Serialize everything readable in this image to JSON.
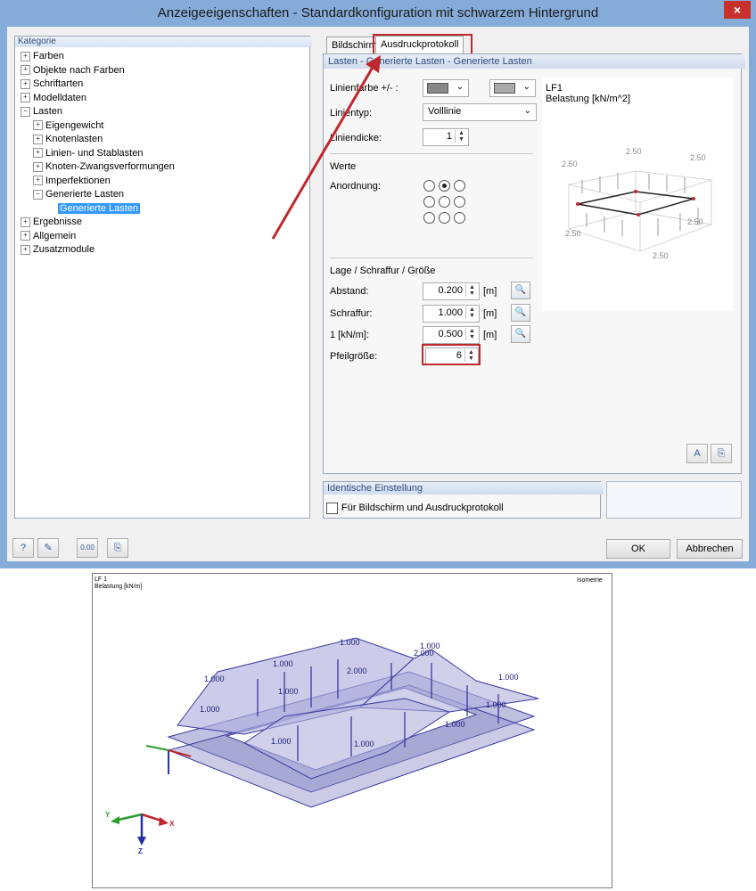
{
  "window": {
    "title": "Anzeigeeigenschaften - Standardkonfiguration mit schwarzem Hintergrund",
    "close": "×"
  },
  "tree": {
    "header": "Kategorie",
    "items": [
      {
        "label": "Farben",
        "exp": "+"
      },
      {
        "label": "Objekte nach Farben",
        "exp": "+"
      },
      {
        "label": "Schriftarten",
        "exp": "+"
      },
      {
        "label": "Modelldaten",
        "exp": "+"
      },
      {
        "label": "Lasten",
        "exp": "−"
      },
      {
        "label": "Eigengewicht",
        "exp": "+"
      },
      {
        "label": "Knotenlasten",
        "exp": "+"
      },
      {
        "label": "Linien- und Stablasten",
        "exp": "+"
      },
      {
        "label": "Knoten-Zwangsverformungen",
        "exp": "+"
      },
      {
        "label": "Imperfektionen",
        "exp": "+"
      },
      {
        "label": "Generierte Lasten",
        "exp": "−"
      },
      {
        "label": "Generierte Lasten",
        "exp": ""
      },
      {
        "label": "Ergebnisse",
        "exp": "+"
      },
      {
        "label": "Allgemein",
        "exp": "+"
      },
      {
        "label": "Zusatzmodule",
        "exp": "+"
      }
    ]
  },
  "tabs": {
    "screen": "Bildschirm",
    "print": "Ausdruckprotokoll"
  },
  "panel": {
    "header": "Lasten - Generierte Lasten - Generierte Lasten",
    "line_color_label": "Linienfarbe +/- :",
    "line_type_label": "Linientyp:",
    "line_type_value": "Volllinie",
    "line_width_label": "Liniendicke:",
    "line_width_value": "1",
    "values_label": "Werte",
    "arrangement_label": "Anordnung:",
    "position_group": "Lage / Schraffur / Größe",
    "distance_label": "Abstand:",
    "distance_value": "0.200",
    "hatch_label": "Schraffur:",
    "hatch_value": "1.000",
    "scale_label": "1 [kN/m]:",
    "scale_value": "0.500",
    "unit_m": "[m]",
    "arrow_size_label": "Pfeilgröße:",
    "arrow_size_value": "6"
  },
  "preview": {
    "line1": "LF1",
    "line2": "Belastung [kN/m^2]",
    "labels": [
      "2.50",
      "2.50",
      "2.50",
      "2.50",
      "2.50",
      "2.50"
    ]
  },
  "ident": {
    "header": "Identische Einstellung",
    "checkbox_label": "Für Bildschirm und Ausdruckprotokoll"
  },
  "buttons": {
    "ok": "OK",
    "cancel": "Abbrechen"
  },
  "printout": {
    "line1": "LF 1",
    "line2": "Belastung [kN/m]",
    "view": "Isometrie",
    "load_labels": [
      "1.000",
      "1.000",
      "1.000",
      "2.000",
      "2.000",
      "1.000",
      "1.000",
      "1.000",
      "1.000",
      "1.000",
      "1.000",
      "1.000",
      "1.000"
    ],
    "axes": {
      "x": "X",
      "y": "Y",
      "z": "Z"
    }
  },
  "colors": {
    "accent": "#c0282d",
    "titlebar": "#85acd9",
    "selection": "#3399ff",
    "load_fill": "#a9a9d6",
    "member": "#4b4bb0"
  }
}
